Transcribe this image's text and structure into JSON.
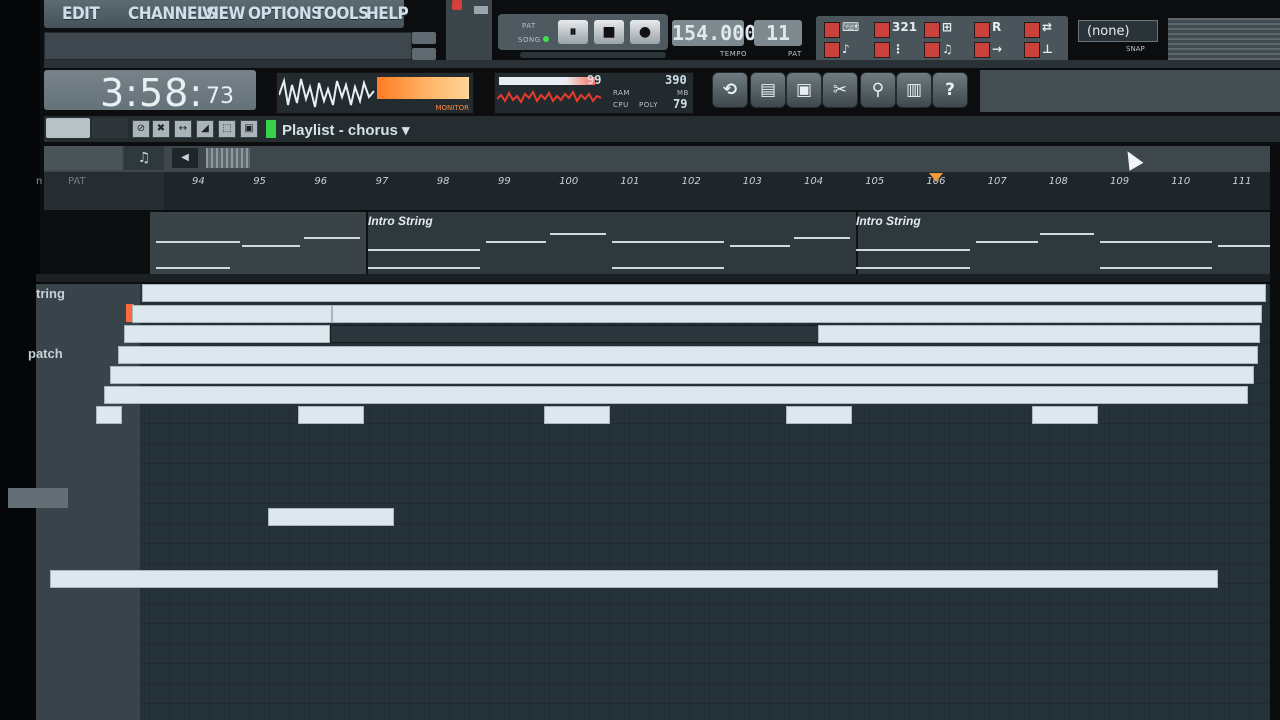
{
  "menu": {
    "items": [
      "EDIT",
      "CHANNELS",
      "VIEW",
      "OPTIONS",
      "TOOLS",
      "HELP"
    ]
  },
  "transport": {
    "pat_label": "PAT",
    "song_label": "SONG",
    "pause_icon": "⏸",
    "stop_icon": "■",
    "record_icon": "●",
    "tempo_value": "154.000",
    "tempo_label": "TEMPO",
    "pat_value": "11",
    "pat_display_label": "PAT"
  },
  "snap": {
    "value": "(none)",
    "label": "SNAP"
  },
  "time": {
    "main": "3:58:",
    "small": "73"
  },
  "monitor": {
    "label": "MONITOR"
  },
  "cpu": {
    "cpu_value": "99",
    "ram_value": "390",
    "mb_label": "MB",
    "poly_value": "79",
    "ram_label": "RAM",
    "cpu_label": "CPU",
    "poly_label": "POLY"
  },
  "tools": {
    "icons": [
      "undo-icon",
      "save-icon",
      "save-as-icon",
      "cut-icon",
      "mic-icon",
      "file-icon",
      "help-icon"
    ],
    "glyphs": [
      "⟲",
      "▤",
      "▣",
      "✂",
      "⚲",
      "▥",
      "?"
    ]
  },
  "playlist": {
    "title": "Playlist - chorus ▾"
  },
  "ruler": {
    "left_label": "n",
    "pat_label": "PAT",
    "bars": [
      "94",
      "95",
      "96",
      "97",
      "98",
      "99",
      "100",
      "101",
      "102",
      "103",
      "104",
      "105",
      "106",
      "107",
      "108",
      "109",
      "110",
      "111"
    ]
  },
  "pattern_track": {
    "clips": [
      "Intro String",
      "Intro String"
    ]
  },
  "piano_roll": {
    "key_labels": [
      "tring",
      "patch"
    ]
  }
}
